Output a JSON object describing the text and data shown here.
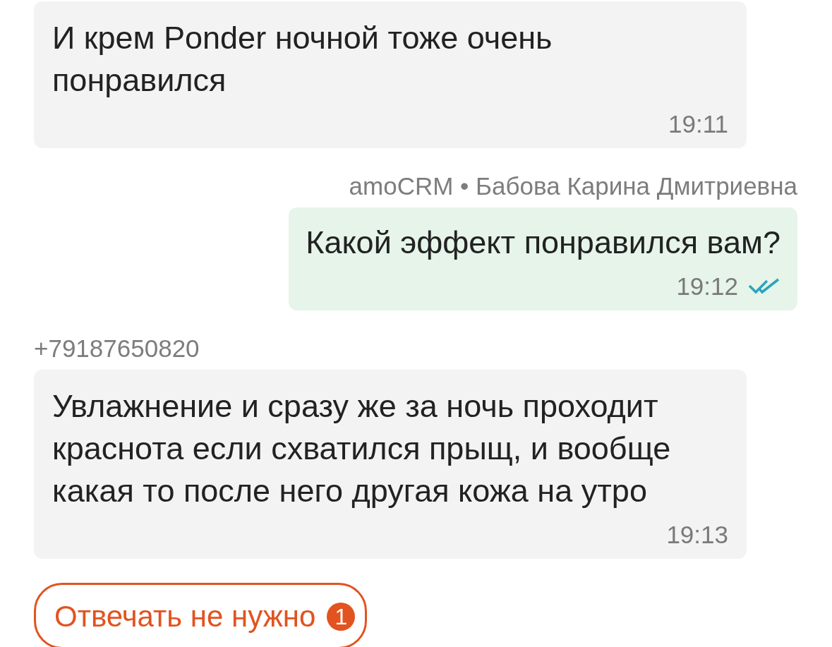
{
  "messages": [
    {
      "kind": "incoming",
      "text": "И крем Ponder ночной тоже очень понравился",
      "time": "19:11"
    },
    {
      "kind": "outgoing",
      "sender": "amoCRM • Бабова Карина Дмитриевна",
      "text": "Какой эффект понравился вам?",
      "time": "19:12",
      "read": true
    },
    {
      "kind": "incoming",
      "sender": "+79187650820",
      "text": "Увлажнение и сразу же за ночь проходит краснота если схватился прыщ, и вообще какая то после него другая кожа на утро",
      "time": "19:13"
    }
  ],
  "action": {
    "label": "Отвечать не нужно",
    "count": "1"
  }
}
